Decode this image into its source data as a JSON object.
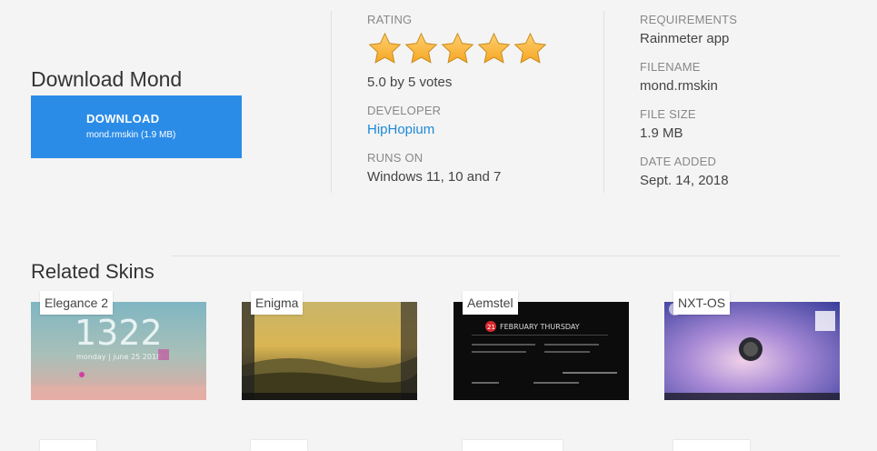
{
  "download": {
    "title": "Download Mond",
    "button_label": "DOWNLOAD",
    "button_sub": "mond.rmskin (1.9 MB)"
  },
  "rating": {
    "label": "RATING",
    "stars": 5,
    "max_stars": 5,
    "summary": "5.0 by 5 votes"
  },
  "developer": {
    "label": "DEVELOPER",
    "value": "HipHopium"
  },
  "runs_on": {
    "label": "RUNS ON",
    "value": "Windows 11, 10 and 7"
  },
  "requirements": {
    "label": "REQUIREMENTS",
    "value": "Rainmeter app"
  },
  "filename": {
    "label": "FILENAME",
    "value": "mond.rmskin"
  },
  "file_size": {
    "label": "FILE SIZE",
    "value": "1.9 MB"
  },
  "date_added": {
    "label": "DATE ADDED",
    "value": "Sept. 14, 2018"
  },
  "related": {
    "title": "Related Skins",
    "skins": [
      {
        "name": "Elegance 2",
        "thumb_text": [
          "1322",
          "monday | june 25 2018"
        ]
      },
      {
        "name": "Enigma"
      },
      {
        "name": "Aemstel",
        "thumb_text": [
          "21",
          "FEBRUARY THURSDAY"
        ]
      },
      {
        "name": "NXT-OS"
      }
    ]
  },
  "colors": {
    "accent": "#2b8ce8",
    "link": "#1e8ad6",
    "star": "#f5a623"
  }
}
